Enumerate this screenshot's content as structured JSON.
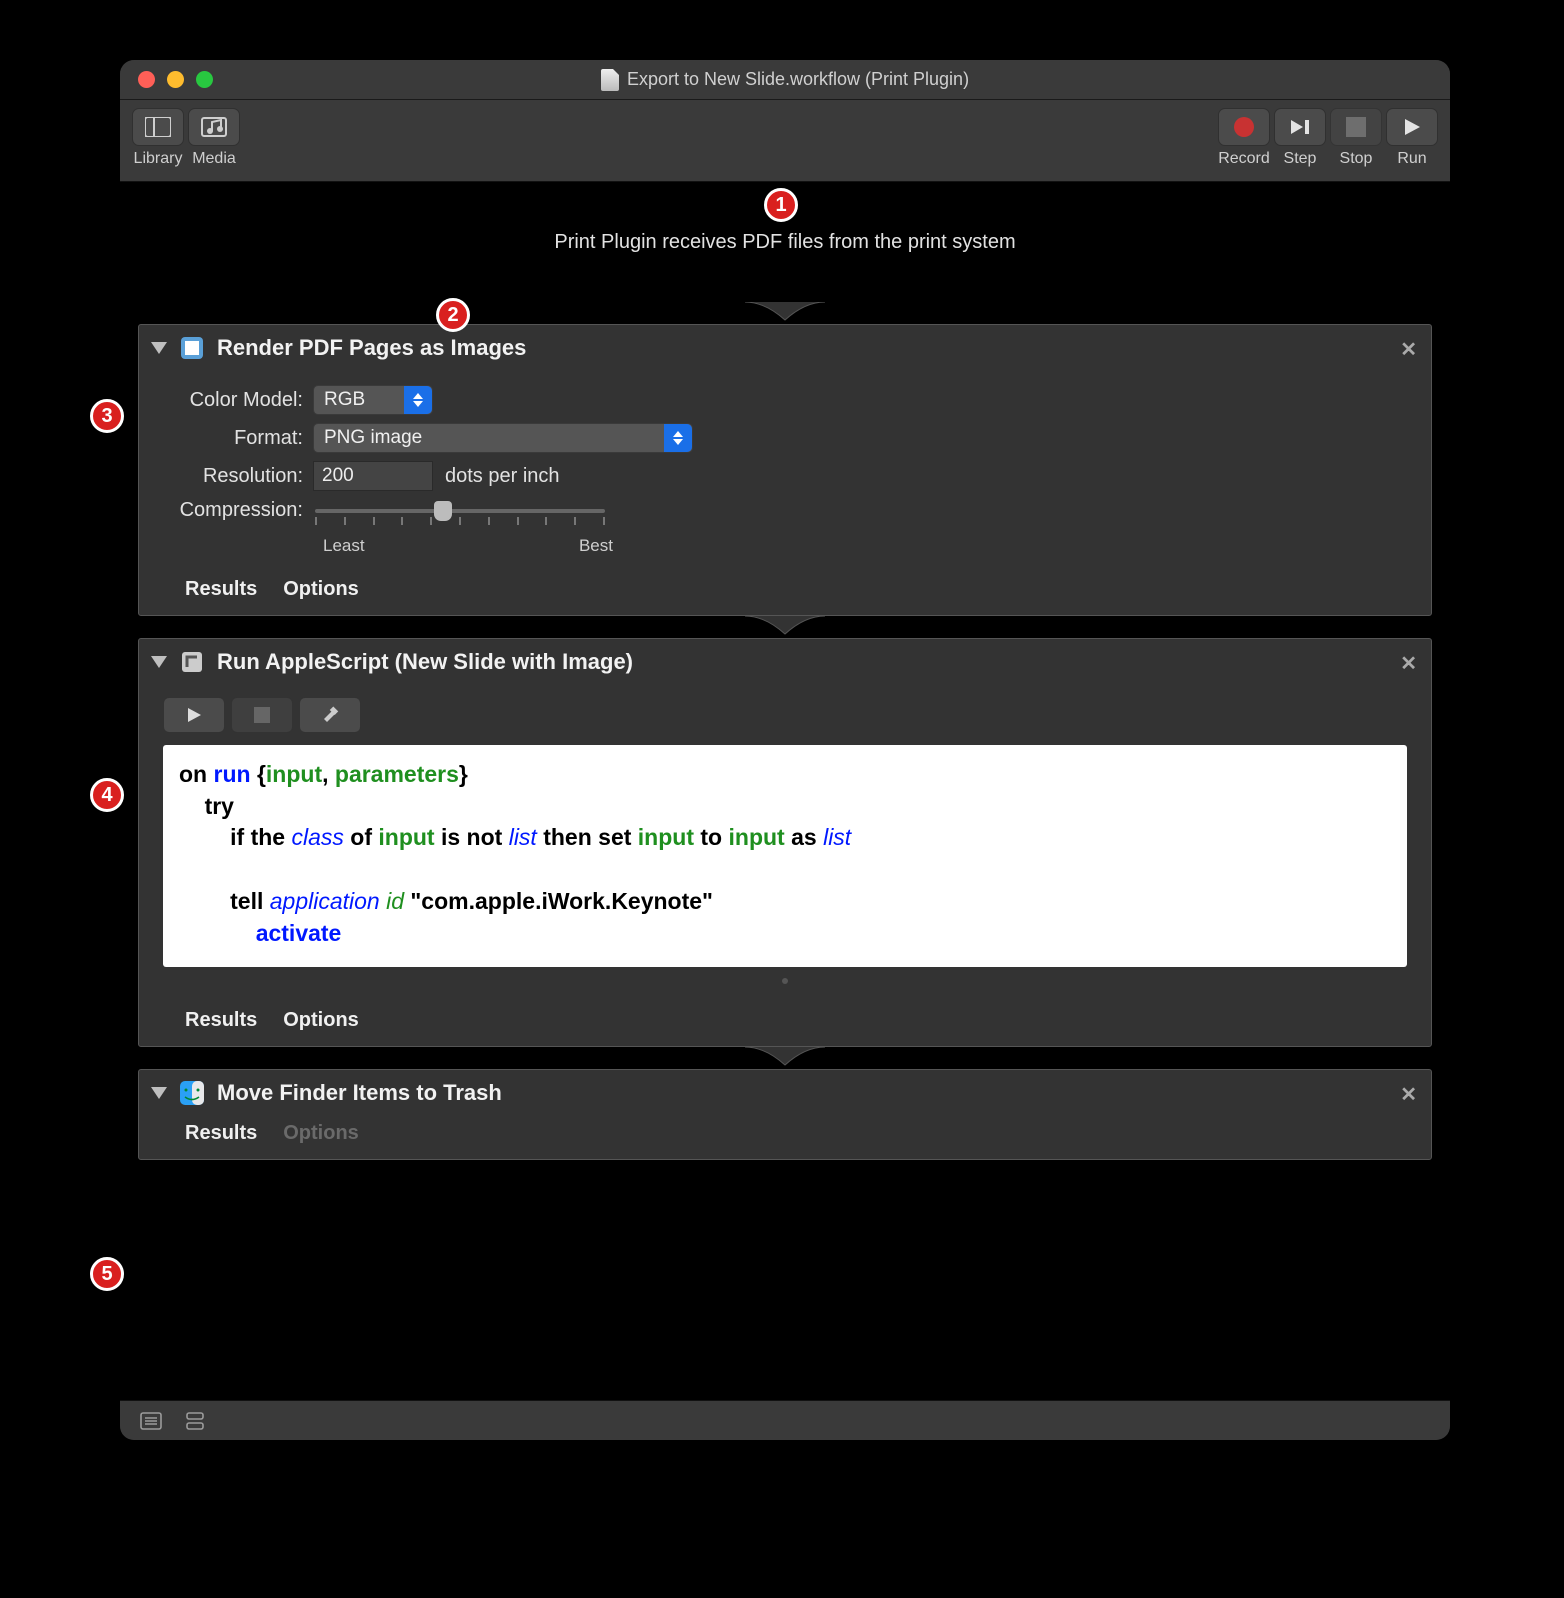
{
  "window": {
    "title": "Export to New Slide.workflow (Print Plugin)"
  },
  "toolbar": {
    "library": "Library",
    "media": "Media",
    "record": "Record",
    "step": "Step",
    "stop": "Stop",
    "run": "Run"
  },
  "callouts": {
    "c1": "1",
    "c2": "2",
    "c3": "3",
    "c4": "4",
    "c5": "5"
  },
  "receiver": {
    "text": "Print Plugin receives PDF files from the print system"
  },
  "action1": {
    "title": "Render PDF Pages as Images",
    "color_model_label": "Color Model:",
    "color_model_value": "RGB",
    "format_label": "Format:",
    "format_value": "PNG image",
    "resolution_label": "Resolution:",
    "resolution_value": "200",
    "resolution_unit": "dots per inch",
    "compression_label": "Compression:",
    "compression_min": "Least",
    "compression_max": "Best",
    "results": "Results",
    "options": "Options"
  },
  "action2": {
    "title": "Run AppleScript (New Slide with Image)",
    "code_tokens": [
      [
        "kw-black",
        "on "
      ],
      [
        "kw-blue",
        "run"
      ],
      [
        "kw-black",
        " {"
      ],
      [
        "kw-green",
        "input"
      ],
      [
        "kw-black",
        ", "
      ],
      [
        "kw-green",
        "parameters"
      ],
      [
        "kw-black",
        "}"
      ],
      [
        "nl",
        ""
      ],
      [
        "indent",
        "    "
      ],
      [
        "kw-black",
        "try"
      ],
      [
        "nl",
        ""
      ],
      [
        "indent",
        "        "
      ],
      [
        "kw-black",
        "if the "
      ],
      [
        "kw-ital",
        "class"
      ],
      [
        "kw-black",
        " of "
      ],
      [
        "kw-green",
        "input"
      ],
      [
        "kw-black",
        " is not "
      ],
      [
        "kw-ital",
        "list"
      ],
      [
        "kw-black",
        " then set "
      ],
      [
        "kw-green",
        "input"
      ],
      [
        "kw-black",
        " to "
      ],
      [
        "kw-green",
        "input"
      ],
      [
        "kw-black",
        " as "
      ],
      [
        "kw-ital",
        "list"
      ],
      [
        "nl",
        ""
      ],
      [
        "nl",
        ""
      ],
      [
        "indent",
        "        "
      ],
      [
        "kw-black",
        "tell "
      ],
      [
        "kw-ital",
        "application"
      ],
      [
        "kw-black",
        " "
      ],
      [
        "kw-greenital",
        "id"
      ],
      [
        "kw-black",
        " \"com.apple.iWork.Keynote\""
      ],
      [
        "nl",
        ""
      ],
      [
        "indent",
        "            "
      ],
      [
        "kw-blue",
        "activate"
      ]
    ],
    "results": "Results",
    "options": "Options"
  },
  "action3": {
    "title": "Move Finder Items to Trash",
    "results": "Results",
    "options": "Options"
  }
}
